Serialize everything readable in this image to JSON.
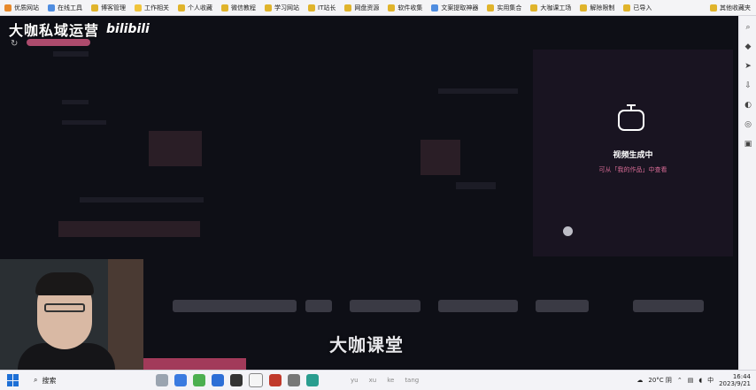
{
  "bookmarks": [
    {
      "label": "优质网站",
      "color": "#e88a2b"
    },
    {
      "label": "在线工具",
      "color": "#4f8de0"
    },
    {
      "label": "博客管理",
      "color": "#e0b42b"
    },
    {
      "label": "工作相关",
      "color": "#f0c43b"
    },
    {
      "label": "个人收藏",
      "color": "#e0b42b"
    },
    {
      "label": "微信教程",
      "color": "#e0b42b"
    },
    {
      "label": "学习网站",
      "color": "#e0b42b"
    },
    {
      "label": "IT站长",
      "color": "#e0b42b"
    },
    {
      "label": "网盘资源",
      "color": "#e0b42b"
    },
    {
      "label": "软件收集",
      "color": "#e0b42b"
    },
    {
      "label": "文案提取神器",
      "color": "#4f8de0"
    },
    {
      "label": "实用集合",
      "color": "#e0b42b"
    },
    {
      "label": "大咖课工场",
      "color": "#e0b42b"
    },
    {
      "label": "解除限制",
      "color": "#e0b42b"
    },
    {
      "label": "已导入",
      "color": "#e0b42b"
    }
  ],
  "bookmarks_more": "其他收藏夹",
  "overlay": {
    "watermark_title": "大咖私域运营",
    "watermark_logo": "bilibili",
    "bottom_watermark": "大咖课堂"
  },
  "generation": {
    "title": "视频生成中",
    "subtitle": "可从「我的作品」中查看"
  },
  "taskbar": {
    "search_placeholder": "搜索",
    "ime_hint": [
      "yu",
      "xu",
      "ke",
      "tang"
    ],
    "weather": "20°C 阴",
    "ime_mode": "中",
    "time": "16:44",
    "date": "2023/9/21"
  },
  "sidebar_icons": [
    "search-icon",
    "tag-icon",
    "send-icon",
    "download-icon",
    "shield-icon",
    "compass-icon",
    "game-icon"
  ]
}
